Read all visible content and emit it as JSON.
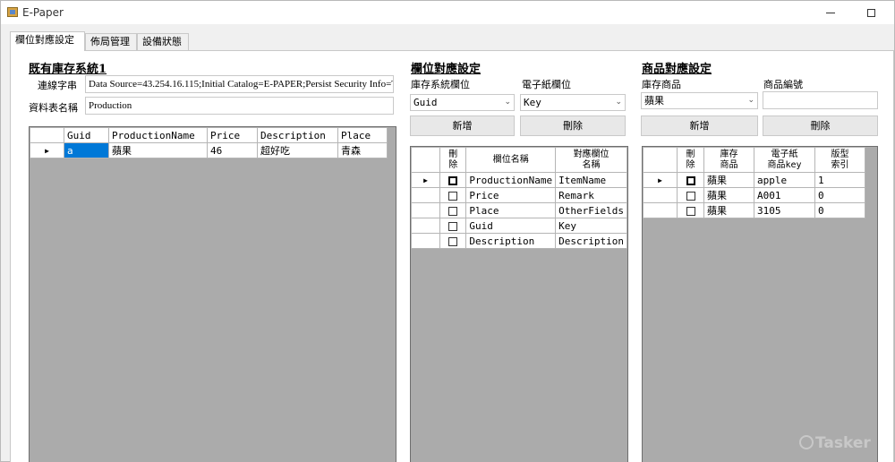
{
  "window": {
    "title": "E-Paper"
  },
  "tabs": [
    {
      "label": "欄位對應設定"
    },
    {
      "label": "佈局管理"
    },
    {
      "label": "設備狀態"
    }
  ],
  "existing_system": {
    "title": "既有庫存系統1",
    "connection_label": "連線字串",
    "connection_value": "Data Source=43.254.16.115;Initial Catalog=E-PAPER;Persist Security Info=True;User",
    "table_label": "資料表名稱",
    "table_value": "Production",
    "grid": {
      "columns": [
        "Guid",
        "ProductionName",
        "Price",
        "Description",
        "Place"
      ],
      "rows": [
        {
          "guid": "a",
          "name": "蘋果",
          "price": "46",
          "description": "超好吃",
          "place": "青森"
        }
      ]
    }
  },
  "field_mapping": {
    "title": "欄位對應設定",
    "source_label": "庫存系統欄位",
    "source_value": "Guid",
    "target_label": "電子紙欄位",
    "target_value": "Key",
    "add_label": "新增",
    "delete_label": "刪除",
    "grid": {
      "col_delete": "刪\n除",
      "col_field": "欄位名稱",
      "col_mapped": "對應欄位\n名稱",
      "rows": [
        {
          "field": "ProductionName",
          "mapped": "ItemName"
        },
        {
          "field": "Price",
          "mapped": "Remark"
        },
        {
          "field": "Place",
          "mapped": "OtherFields"
        },
        {
          "field": "Guid",
          "mapped": "Key"
        },
        {
          "field": "Description",
          "mapped": "Description"
        }
      ]
    }
  },
  "product_mapping": {
    "title": "商品對應設定",
    "item_label": "庫存商品",
    "item_value": "蘋果",
    "code_label": "商品編號",
    "code_value": "",
    "add_label": "新增",
    "delete_label": "刪除",
    "grid": {
      "col_delete": "刪\n除",
      "col_item": "庫存\n商品",
      "col_key": "電子紙\n商品key",
      "col_index": "版型\n索引",
      "rows": [
        {
          "item": "蘋果",
          "key": "apple",
          "index": "1"
        },
        {
          "item": "蘋果",
          "key": "A001",
          "index": "0"
        },
        {
          "item": "蘋果",
          "key": "3105",
          "index": "0"
        }
      ]
    }
  },
  "watermark": "Tasker"
}
